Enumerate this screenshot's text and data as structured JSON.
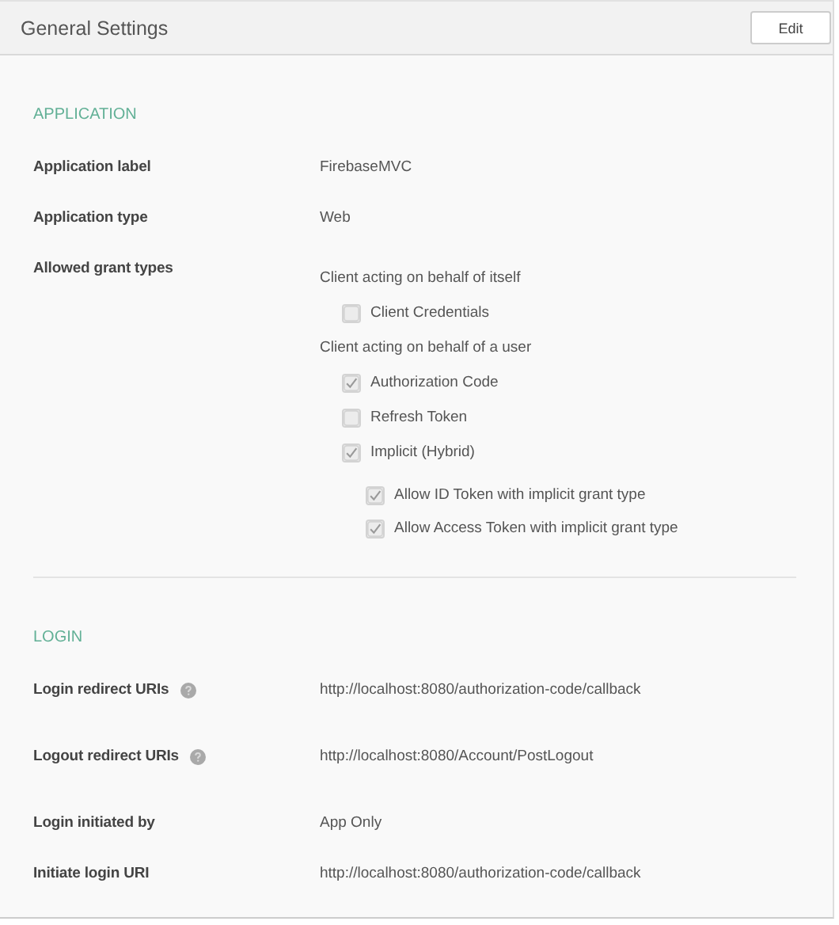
{
  "header": {
    "title": "General Settings",
    "edit_button": "Edit"
  },
  "sections": [
    {
      "title": "APPLICATION",
      "rows": [
        {
          "kind": "text",
          "label": "Application label",
          "help": false,
          "value": "FirebaseMVC"
        },
        {
          "kind": "text",
          "label": "Application type",
          "help": false,
          "value": "Web"
        },
        {
          "kind": "grants",
          "label": "Allowed grant types",
          "help": false,
          "groups": [
            {
              "heading": "Client acting on behalf of itself",
              "options": [
                {
                  "label": "Client Credentials",
                  "checked": false
                }
              ]
            },
            {
              "heading": "Client acting on behalf of a user",
              "options": [
                {
                  "label": "Authorization Code",
                  "checked": true
                },
                {
                  "label": "Refresh Token",
                  "checked": false
                },
                {
                  "label": "Implicit (Hybrid)",
                  "checked": true,
                  "children": [
                    {
                      "label": "Allow ID Token with implicit grant type",
                      "checked": true
                    },
                    {
                      "label": "Allow Access Token with implicit grant type",
                      "checked": true
                    }
                  ]
                }
              ]
            }
          ]
        }
      ]
    },
    {
      "title": "LOGIN",
      "rows": [
        {
          "kind": "text",
          "label": "Login redirect URIs",
          "help": true,
          "value": "http://localhost:8080/authorization-code/callback"
        },
        {
          "kind": "text",
          "label": "Logout redirect URIs",
          "help": true,
          "value": "http://localhost:8080/Account/PostLogout"
        },
        {
          "kind": "text",
          "label": "Login initiated by",
          "help": false,
          "value": "App Only"
        },
        {
          "kind": "text",
          "label": "Initiate login URI",
          "help": false,
          "value": "http://localhost:8080/authorization-code/callback"
        }
      ]
    }
  ]
}
